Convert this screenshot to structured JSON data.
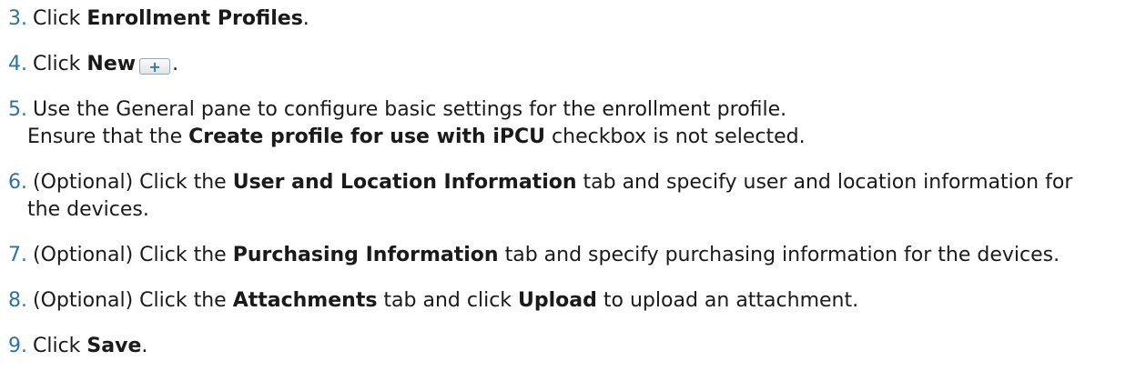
{
  "steps": [
    {
      "num": "3.",
      "pre": "Click ",
      "bold": "Enrollment Profiles",
      "post": "."
    },
    {
      "num": "4.",
      "pre": "Click ",
      "bold": "New",
      "icon": "+",
      "post": "."
    },
    {
      "num": "5.",
      "line1": "Use the General pane to configure basic settings for the enrollment profile.",
      "pre": "Ensure that the ",
      "bold": "Create profile for use with iPCU",
      "post": " checkbox is not selected."
    },
    {
      "num": "6.",
      "pre": "(Optional) Click the ",
      "bold": "User and Location Information",
      "post": " tab and specify user and location information for",
      "cont": "the devices."
    },
    {
      "num": "7.",
      "pre": "(Optional) Click the ",
      "bold": "Purchasing Information",
      "post": " tab and specify purchasing information for the devices."
    },
    {
      "num": "8.",
      "pre": "(Optional) Click the ",
      "bold": "Attachments",
      "mid": " tab and click ",
      "bold2": "Upload",
      "post": " to upload an attachment."
    },
    {
      "num": "9.",
      "pre": "Click ",
      "bold": "Save",
      "post": "."
    }
  ],
  "icons": {
    "new": "plus-icon"
  },
  "colors": {
    "step_number": "#2a73a8",
    "text": "#1a1a1a"
  }
}
